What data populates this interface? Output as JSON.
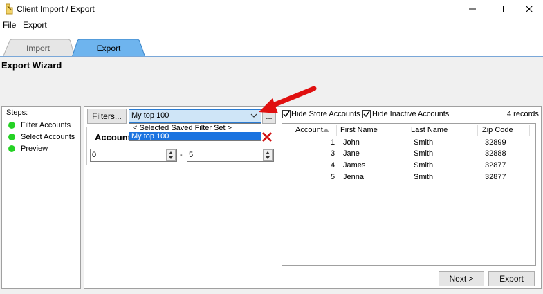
{
  "window": {
    "title": "Client Import / Export"
  },
  "menu": {
    "file": "File",
    "export": "Export"
  },
  "tabs": {
    "import": "Import",
    "export": "Export"
  },
  "wizard": {
    "title": "Export Wizard"
  },
  "steps": {
    "heading": "Steps:",
    "items": [
      "Filter Accounts",
      "Select Accounts",
      "Preview"
    ]
  },
  "filters": {
    "button_label": "Filters...",
    "selected": "My top 100",
    "browse_label": "...",
    "options": [
      "< Selected Saved Filter Set >",
      "My top 100"
    ]
  },
  "account_filter": {
    "label": "Account",
    "from_value": "0",
    "separator": "-",
    "to_value": "5"
  },
  "options": {
    "hide_store_label": "Hide Store Accounts",
    "hide_inactive_label": "Hide Inactive Accounts",
    "record_count": "4 records"
  },
  "table": {
    "columns": [
      "Account",
      "First Name",
      "Last Name",
      "Zip Code"
    ],
    "rows": [
      [
        "1",
        "John",
        "Smith",
        "32899"
      ],
      [
        "3",
        "Jane",
        "Smith",
        "32888"
      ],
      [
        "4",
        "James",
        "Smith",
        "32877"
      ],
      [
        "5",
        "Jenna",
        "Smith",
        "32877"
      ]
    ]
  },
  "footer": {
    "next_label": "Next >",
    "export_label": "Export"
  },
  "colors": {
    "accent": "#2a7bd1",
    "step_dot": "#25d225",
    "arrow": "#e01010",
    "delete": "#d01010"
  }
}
